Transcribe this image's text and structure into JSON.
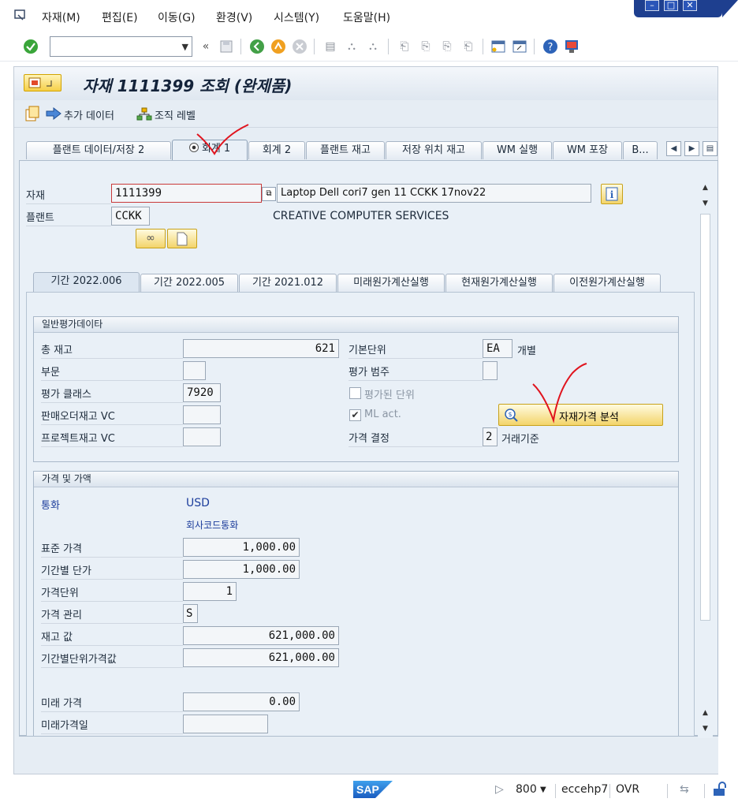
{
  "menu": {
    "items": [
      {
        "label": "자재(M)"
      },
      {
        "label": "편집(E)"
      },
      {
        "label": "이동(G)"
      },
      {
        "label": "환경(V)"
      },
      {
        "label": "시스템(Y)"
      },
      {
        "label": "도움말(H)"
      }
    ]
  },
  "toolbar": {
    "command_value": "",
    "icons": [
      "ok-check-icon",
      "back-icon",
      "save-icon",
      "back-green-icon",
      "exit-icon",
      "cancel-icon",
      "print-icon",
      "find-icon",
      "find-next-icon",
      "first-page-icon",
      "prev-page-icon",
      "next-page-icon",
      "last-page-icon",
      "new-session-icon",
      "shortcut-icon",
      "help-icon",
      "layout-icon"
    ]
  },
  "header": {
    "title": "자재 1111399 조회 (완제품)"
  },
  "appbar": {
    "additional_data": "추가 데이터",
    "org_levels": "조직 레벨"
  },
  "tabs": [
    {
      "label": "플랜트 데이터/저장 2"
    },
    {
      "label": "회계 1"
    },
    {
      "label": "회계 2"
    },
    {
      "label": "플랜트 재고"
    },
    {
      "label": "저장 위치 재고"
    },
    {
      "label": "WM 실행"
    },
    {
      "label": "WM 포장"
    },
    {
      "label": "B..."
    }
  ],
  "material": {
    "label_material": "자재",
    "material_no": "1111399",
    "description": "Laptop Dell cori7 gen 11 CCKK 17nov22",
    "label_plant": "플랜트",
    "plant": "CCKK",
    "plant_name": "CREATIVE COMPUTER SERVICES"
  },
  "subtabs": [
    {
      "label": "기간 2022.006"
    },
    {
      "label": "기간 2022.005"
    },
    {
      "label": "기간 2021.012"
    },
    {
      "label": "미래원가계산실행"
    },
    {
      "label": "현재원가계산실행"
    },
    {
      "label": "이전원가계산실행"
    }
  ],
  "general": {
    "title": "일반평가데이타",
    "total_stock_label": "총 재고",
    "total_stock": "621",
    "division_label": "부문",
    "division": "",
    "valuation_class_label": "평가 클래스",
    "valuation_class": "7920",
    "so_stock_vc_label": "판매오더재고 VC",
    "so_stock_vc": "",
    "project_stock_vc_label": "프로젝트재고 VC",
    "project_stock_vc": "",
    "base_unit_label": "기본단위",
    "base_unit": "EA",
    "base_unit_text": "개별",
    "valuation_category_label": "평가 범주",
    "valuation_category": "",
    "valuated_unit_label": "평가된 단위",
    "valuated_unit_checked": false,
    "ml_act_label": "ML act.",
    "ml_act_checked": true,
    "price_analysis_button": "자재가격 분석",
    "price_determination_label": "가격 결정",
    "price_determination": "2",
    "price_determination_text": "거래기준"
  },
  "prices": {
    "title": "가격 및 가액",
    "currency_label": "통화",
    "currency": "USD",
    "company_code_currency": "회사코드통화",
    "standard_price_label": "표준 가격",
    "standard_price": "1,000.00",
    "periodic_unit_price_label": "기간별 단가",
    "periodic_unit_price": "1,000.00",
    "price_unit_label": "가격단위",
    "price_unit": "1",
    "price_control_label": "가격 관리",
    "price_control": "S",
    "stock_value_label": "재고 값",
    "stock_value": "621,000.00",
    "periodic_stock_value_label": "기간별단위가격값",
    "periodic_stock_value": "621,000.00",
    "future_price_label": "미래 가격",
    "future_price": "0.00",
    "future_price_date_label": "미래가격일",
    "future_price_date": ""
  },
  "statusbar": {
    "logo": "SAP",
    "client": "800",
    "system": "eccehp7",
    "mode": "OVR"
  },
  "colors": {
    "accent": "#1d3e9c",
    "window_controls": "#1e3f8f",
    "panel": "#e9f0f7",
    "annotation": "#e0141e"
  }
}
